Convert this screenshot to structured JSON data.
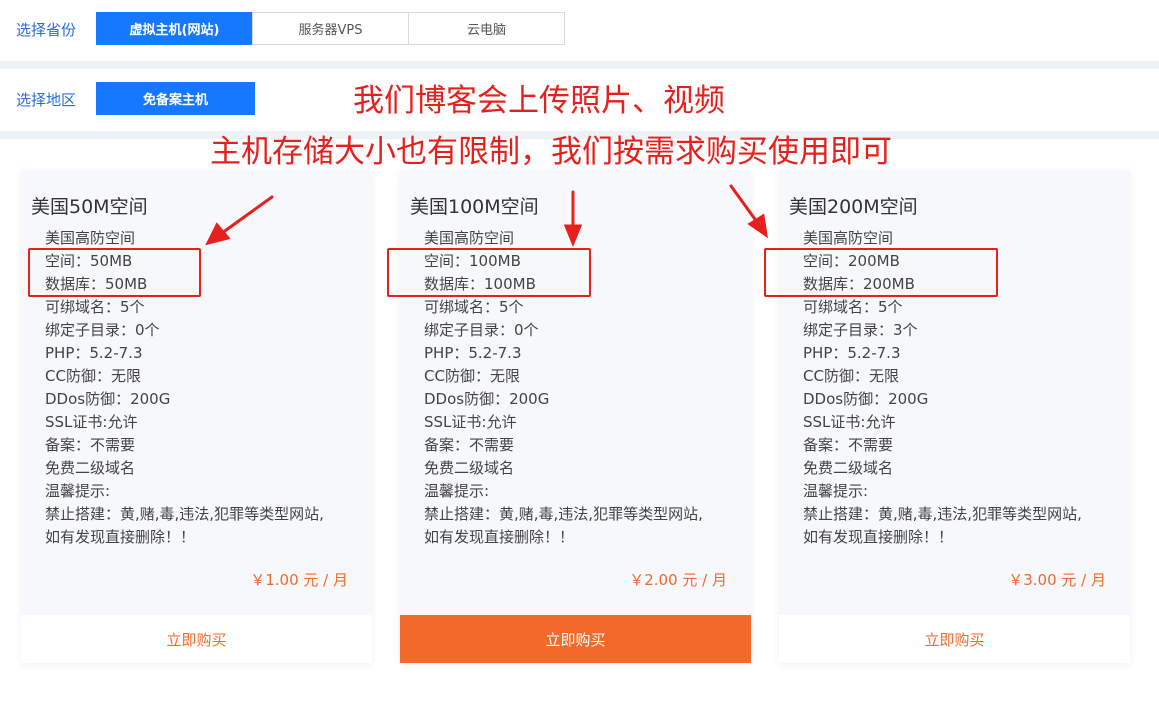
{
  "province": {
    "label": "选择省份",
    "tabs": [
      "虚拟主机(网站)",
      "服务器VPS",
      "云电脑"
    ],
    "active": 0
  },
  "region": {
    "label": "选择地区",
    "tabs": [
      "免备案主机"
    ]
  },
  "annotations": {
    "line1": "我们博客会上传照片、视频",
    "line2": "主机存储大小也有限制，我们按需求购买使用即可"
  },
  "cards": [
    {
      "title": "美国50M空间",
      "features": [
        "美国高防空间",
        "空间：50MB",
        "数据库：50MB",
        "可绑域名：5个",
        "绑定子目录：0个",
        "PHP：5.2-7.3",
        "CC防御：无限",
        "DDos防御：200G",
        "SSL证书:允许",
        "备案：不需要",
        "免费二级域名",
        "温馨提示:",
        "禁止搭建：黄,赌,毒,违法,犯罪等类型网站,",
        "如有发现直接删除！！"
      ],
      "price": "￥1.00 元 / 月",
      "buy_label": "立即购买"
    },
    {
      "title": "美国100M空间",
      "features": [
        "美国高防空间",
        "空间：100MB",
        "数据库：100MB",
        "可绑域名：5个",
        "绑定子目录：0个",
        "PHP：5.2-7.3",
        "CC防御：无限",
        "DDos防御：200G",
        "SSL证书:允许",
        "备案：不需要",
        "免费二级域名",
        "温馨提示:",
        "禁止搭建：黄,赌,毒,违法,犯罪等类型网站,",
        "如有发现直接删除！！"
      ],
      "price": "￥2.00 元 / 月",
      "buy_label": "立即购买"
    },
    {
      "title": "美国200M空间",
      "features": [
        "美国高防空间",
        "空间：200MB",
        "数据库：200MB",
        "可绑域名：5个",
        "绑定子目录：3个",
        "PHP：5.2-7.3",
        "CC防御：无限",
        "DDos防御：200G",
        "SSL证书:允许",
        "备案：不需要",
        "免费二级域名",
        "温馨提示:",
        "禁止搭建：黄,赌,毒,违法,犯罪等类型网站,",
        "如有发现直接删除！！"
      ],
      "price": "￥3.00 元 / 月",
      "buy_label": "立即购买"
    }
  ],
  "colors": {
    "primary": "#1677ff",
    "accent": "#f26a2b",
    "annotation": "#e8201d",
    "label": "#2b6cd9"
  }
}
